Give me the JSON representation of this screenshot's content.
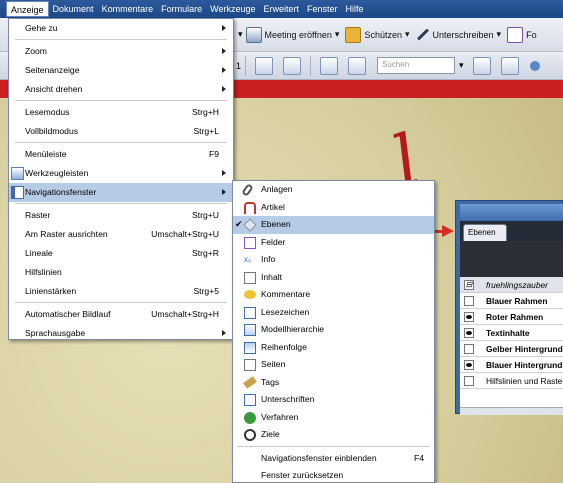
{
  "menubar": [
    "Anzeige",
    "Dokument",
    "Kommentare",
    "Formulare",
    "Werkzeuge",
    "Erweitert",
    "Fenster",
    "Hilfe"
  ],
  "toolbar1": {
    "meeting": "Meeting eröffnen",
    "schuetzen": "Schützen",
    "unterschreiben": "Unterschreiben",
    "formulare_partial": "Fo"
  },
  "toolbar2": {
    "page_number": "1",
    "search_placeholder": "Suchen"
  },
  "anzeige_menu": {
    "gehe_zu": "Gehe zu",
    "zoom": "Zoom",
    "seitenanzeige": "Seitenanzeige",
    "ansicht_drehen": "Ansicht drehen",
    "lesemodus": "Lesemodus",
    "lesemodus_sc": "Strg+H",
    "vollbild": "Vollbildmodus",
    "vollbild_sc": "Strg+L",
    "menueleiste": "Menüleiste",
    "menueleiste_sc": "F9",
    "werkzeugleisten": "Werkzeugleisten",
    "navigationsfenster": "Navigationsfenster",
    "raster": "Raster",
    "raster_sc": "Strg+U",
    "am_raster": "Am Raster ausrichten",
    "am_raster_sc": "Umschalt+Strg+U",
    "lineale": "Lineale",
    "lineale_sc": "Strg+R",
    "hilfslinien": "Hilfslinien",
    "linienstaerken": "Linienstärken",
    "linienstaerken_sc": "Strg+5",
    "autobildlauf": "Automatischer Bildlauf",
    "autobildlauf_sc": "Umschalt+Strg+H",
    "sprachausgabe": "Sprachausgabe"
  },
  "nav_submenu": {
    "anlagen": "Anlagen",
    "artikel": "Artikel",
    "ebenen": "Ebenen",
    "felder": "Felder",
    "info": "Info",
    "inhalt": "Inhalt",
    "kommentare": "Kommentare",
    "lesezeichen": "Lesezeichen",
    "modellhierarchie": "Modellhierarchie",
    "reihenfolge": "Reihenfolge",
    "seiten": "Seiten",
    "tags": "Tags",
    "unterschriften": "Unterschriften",
    "verfahren": "Verfahren",
    "ziele": "Ziele",
    "einblenden": "Navigationsfenster einblenden",
    "einblenden_sc": "F4",
    "zuruecksetzen": "Fenster zurücksetzen"
  },
  "ebenen_panel": {
    "tab": "Ebenen",
    "rows": [
      {
        "label": "fruehlingszauber",
        "box": "⊟"
      },
      {
        "label": "Blauer Rahmen"
      },
      {
        "label": "Roter Rahmen"
      },
      {
        "label": "Textinhalte"
      },
      {
        "label": "Gelber Hintergrund"
      },
      {
        "label": "Blauer Hintergrund"
      },
      {
        "label": "Hilfslinien und Raster"
      }
    ]
  },
  "colors": {
    "menubar": "#1d4787",
    "highlight": "#b6cbe6",
    "banner_red": "#cc1f24",
    "arrow": "#d42d24"
  }
}
